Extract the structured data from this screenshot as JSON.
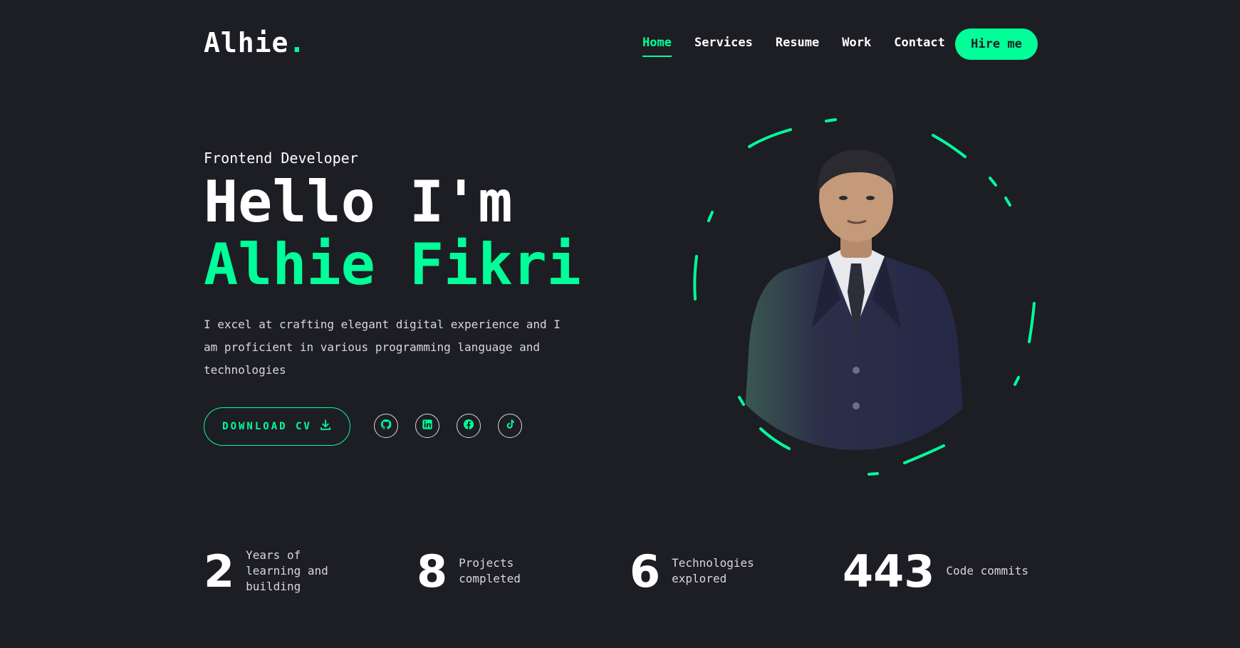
{
  "header": {
    "logo_text": "Alhie",
    "logo_dot": ".",
    "nav": [
      {
        "label": "Home",
        "active": true
      },
      {
        "label": "Services"
      },
      {
        "label": "Resume"
      },
      {
        "label": "Work"
      },
      {
        "label": "Contact"
      }
    ],
    "hire_label": "Hire me"
  },
  "hero": {
    "role": "Frontend Developer",
    "greeting": "Hello I'm",
    "name": "Alhie Fikri",
    "description": "I excel at crafting elegant digital experience and I am proficient in various programming language and technologies",
    "cv_label": "DOWNLOAD CV",
    "socials": [
      {
        "icon": "github-icon"
      },
      {
        "icon": "linkedin-icon"
      },
      {
        "icon": "facebook-icon"
      },
      {
        "icon": "tiktok-icon"
      }
    ]
  },
  "stats": [
    {
      "value": "2",
      "label": "Years of learning and building"
    },
    {
      "value": "8",
      "label": "Projects completed"
    },
    {
      "value": "6",
      "label": "Technologies explored"
    },
    {
      "value": "443",
      "label": "Code commits"
    }
  ],
  "colors": {
    "accent": "#00ff99",
    "background": "#1d1d24",
    "text": "#ffffff"
  }
}
